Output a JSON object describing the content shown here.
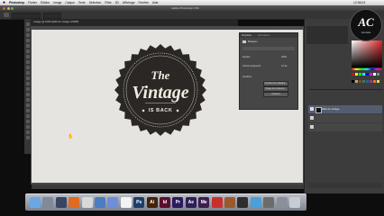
{
  "menubar": {
    "items": [
      "Photoshop",
      "Fichier",
      "Édition",
      "Image",
      "Calque",
      "Texte",
      "Sélection",
      "Filtre",
      "3D",
      "Affichage",
      "Fenêtre",
      "Aide"
    ],
    "clock": "12:56:03"
  },
  "app_title": "Adobe Photoshop CS6",
  "doc_tab": "vintage @ 100% (Effet de vintage, RVB/8)",
  "properties_panel": {
    "tabs": [
      "Propriétés",
      "Informations"
    ],
    "section_label": "Masques",
    "rows": [
      "Densité :",
      "Contour progressif :",
      "Améliorer :"
    ],
    "buttons": [
      "Contour du masque...",
      "Plage de couleurs...",
      "Inverser"
    ],
    "values": [
      "100%",
      "0,0 px"
    ]
  },
  "layers_panel": {
    "layer_name": "Effet de vintage"
  },
  "artwork": {
    "line1": "The",
    "line2": "Vintage",
    "line3": "IS BACK"
  },
  "channel_logo": {
    "initials": "AC",
    "caption": "tutorials"
  },
  "dock": {
    "icons": [
      {
        "name": "finder-icon",
        "color": "#6aa7e6",
        "glyph": ""
      },
      {
        "name": "launchpad-icon",
        "color": "#808a98",
        "glyph": ""
      },
      {
        "name": "mission-control-icon",
        "color": "#3a4660",
        "glyph": ""
      },
      {
        "name": "firefox-icon",
        "color": "#e06a1f",
        "glyph": ""
      },
      {
        "name": "chrome-icon",
        "color": "#d8d8d8",
        "glyph": ""
      },
      {
        "name": "mail-icon",
        "color": "#4b7cc4",
        "glyph": ""
      },
      {
        "name": "itunes-icon",
        "color": "#6c8fd8",
        "glyph": ""
      },
      {
        "name": "calendar-icon",
        "color": "#f2f2f2",
        "glyph": ""
      },
      {
        "name": "photoshop-icon",
        "color": "#1c3f68",
        "glyph": "Ps"
      },
      {
        "name": "illustrator-icon",
        "color": "#452306",
        "glyph": "Ai"
      },
      {
        "name": "indesign-icon",
        "color": "#5a0f2e",
        "glyph": "Id"
      },
      {
        "name": "premiere-icon",
        "color": "#2c1a5c",
        "glyph": "Pr"
      },
      {
        "name": "after-effects-icon",
        "color": "#2e1f57",
        "glyph": "Ae"
      },
      {
        "name": "media-encoder-icon",
        "color": "#3b1d4e",
        "glyph": "Me"
      },
      {
        "name": "creative-cloud-icon",
        "color": "#c8302c",
        "glyph": ""
      },
      {
        "name": "app-icon-a",
        "color": "#9a5b2c",
        "glyph": ""
      },
      {
        "name": "app-icon-b",
        "color": "#2d2d2d",
        "glyph": ""
      },
      {
        "name": "app-icon-c",
        "color": "#4aa0d8",
        "glyph": ""
      },
      {
        "name": "app-icon-d",
        "color": "#6c6c6c",
        "glyph": ""
      },
      {
        "name": "downloads-icon",
        "color": "#8a8f99",
        "glyph": ""
      },
      {
        "name": "trash-icon",
        "color": "#c7cbd2",
        "glyph": ""
      }
    ]
  }
}
